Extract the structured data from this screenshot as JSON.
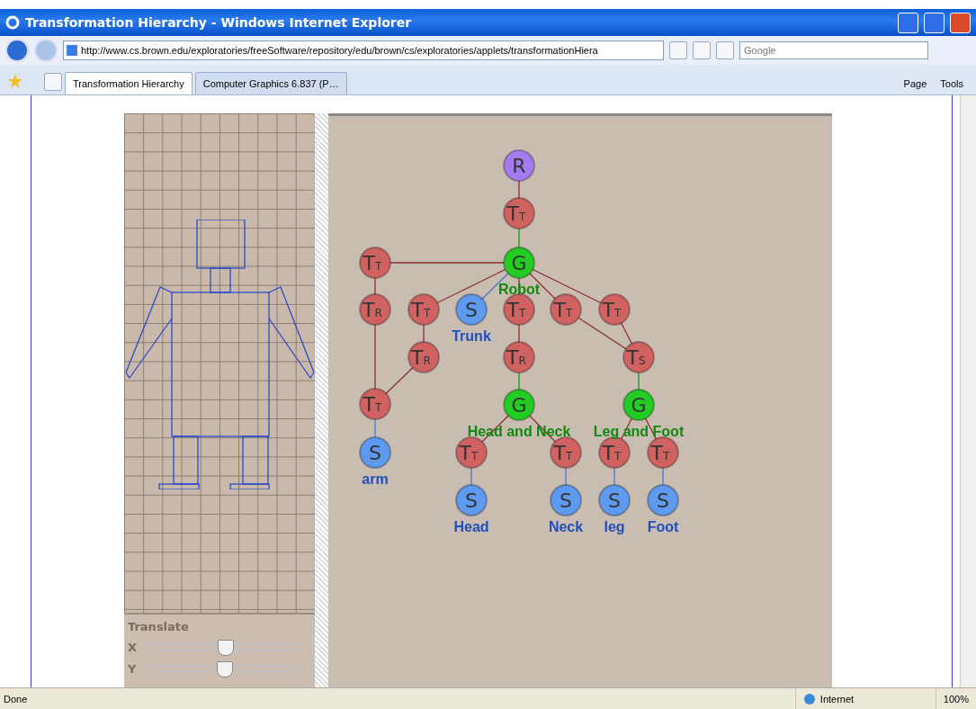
{
  "window": {
    "title": "Transformation Hierarchy - Windows Internet Explorer"
  },
  "address_bar": {
    "url": "http://www.cs.brown.edu/exploratories/freeSoftware/repository/edu/brown/cs/exploratories/applets/transformationHiera"
  },
  "search": {
    "placeholder": "Google"
  },
  "tabs": [
    {
      "label": "Transformation Hierarchy",
      "selected": true
    },
    {
      "label": "Computer Graphics 6.837 (P…",
      "selected": false
    }
  ],
  "command_bar": [
    "Page",
    "Tools"
  ],
  "controls": {
    "title": "Translate",
    "sliders": [
      {
        "label": "X",
        "level": 0.5
      },
      {
        "label": "Y",
        "level": 0.5
      }
    ]
  },
  "graph": {
    "nodes": [
      {
        "kind": "root",
        "letter": "R"
      },
      {
        "kind": "transform",
        "letter": "T",
        "sub": "T"
      },
      {
        "kind": "transform",
        "letter": "T",
        "sub": "T"
      },
      {
        "kind": "group",
        "letter": "G",
        "name": "Robot"
      },
      {
        "kind": "transform",
        "letter": "T",
        "sub": "R"
      },
      {
        "kind": "transform",
        "letter": "T",
        "sub": "T"
      },
      {
        "kind": "shape",
        "letter": "S",
        "name": "Trunk"
      },
      {
        "kind": "transform",
        "letter": "T",
        "sub": "T"
      },
      {
        "kind": "transform",
        "letter": "T",
        "sub": "T"
      },
      {
        "kind": "transform",
        "letter": "T",
        "sub": "T"
      },
      {
        "kind": "transform",
        "letter": "T",
        "sub": "R"
      },
      {
        "kind": "transform",
        "letter": "T",
        "sub": "R"
      },
      {
        "kind": "transform",
        "letter": "T",
        "sub": "S"
      },
      {
        "kind": "transform",
        "letter": "T",
        "sub": "T"
      },
      {
        "kind": "group",
        "letter": "G",
        "name": "Head and Neck"
      },
      {
        "kind": "group",
        "letter": "G",
        "name": "Leg and Foot"
      },
      {
        "kind": "shape",
        "letter": "S",
        "name": "arm"
      },
      {
        "kind": "transform",
        "letter": "T",
        "sub": "T"
      },
      {
        "kind": "transform",
        "letter": "T",
        "sub": "T"
      },
      {
        "kind": "transform",
        "letter": "T",
        "sub": "T"
      },
      {
        "kind": "transform",
        "letter": "T",
        "sub": "T"
      },
      {
        "kind": "shape",
        "letter": "S",
        "name": "Head"
      },
      {
        "kind": "shape",
        "letter": "S",
        "name": "Neck"
      },
      {
        "kind": "shape",
        "letter": "S",
        "name": "leg"
      },
      {
        "kind": "shape",
        "letter": "S",
        "name": "Foot"
      }
    ]
  },
  "status_bar": {
    "text": "Done",
    "zone": "Internet",
    "zoom": "100%"
  }
}
